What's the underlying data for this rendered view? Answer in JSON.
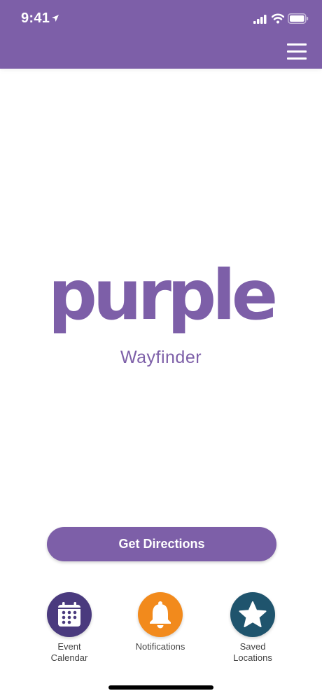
{
  "status_bar": {
    "time": "9:41"
  },
  "header": {
    "menu_icon": "hamburger-menu-icon"
  },
  "logo": {
    "wordmark": "purple",
    "subtitle": "Wayfinder"
  },
  "actions": {
    "directions_label": "Get Directions"
  },
  "tiles": [
    {
      "label": "Event\nCalendar",
      "icon": "calendar-icon",
      "color": "#4a3a7e"
    },
    {
      "label": "Notifications",
      "icon": "bell-icon",
      "color": "#f28a1c"
    },
    {
      "label": "Saved\nLocations",
      "icon": "star-icon",
      "color": "#1f546d"
    }
  ],
  "colors": {
    "brand": "#7d5fa8",
    "calendar": "#4a3a7e",
    "notifications": "#f28a1c",
    "saved": "#1f546d"
  }
}
